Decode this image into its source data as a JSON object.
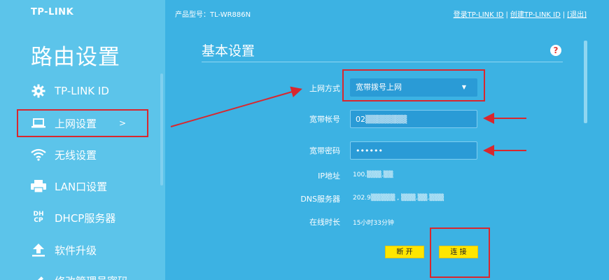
{
  "brand": "TP-LINK",
  "sidebar": {
    "title": "路由设置",
    "items": [
      {
        "label": "TP-LINK ID",
        "icon": "gear-icon"
      },
      {
        "label": "上网设置",
        "icon": "laptop-icon",
        "chevron": ">"
      },
      {
        "label": "无线设置",
        "icon": "wifi-icon"
      },
      {
        "label": "LAN口设置",
        "icon": "printer-icon"
      },
      {
        "label": "DHCP服务器",
        "icon": "dhcp-icon",
        "icon_text_top": "DH",
        "icon_text_bottom": "CP"
      },
      {
        "label": "软件升级",
        "icon": "upload-icon"
      },
      {
        "label": "修改管理员密码",
        "icon": "edit-icon"
      }
    ]
  },
  "header": {
    "model_label": "产品型号：TL-WR886N",
    "login_link": "登录TP-LINK ID",
    "sep1": "|",
    "create_link": "创建TP-LINK ID",
    "sep2": "|",
    "logout_link": "[退出]"
  },
  "section": {
    "title": "基本设置",
    "help": "?"
  },
  "form": {
    "connection_type_label": "上网方式",
    "connection_type_value": "宽带拨号上网",
    "account_label": "宽带帐号",
    "account_value": "02▒▒▒▒▒▒▒",
    "password_label": "宽带密码",
    "password_value": "••••••",
    "ip_label": "IP地址",
    "ip_value": "100.▒▒▒.▒▒",
    "dns_label": "DNS服务器",
    "dns_value": "202.9▒▒▒▒▒ , ▒▒▒.▒▒.▒▒▒",
    "uptime_label": "在线时长",
    "uptime_value": "15小时33分钟"
  },
  "buttons": {
    "disconnect": "断 开",
    "connect": "连 接"
  },
  "colors": {
    "sidebar_bg": "#5cc4ea",
    "main_bg": "#3cb2e3",
    "field_bg": "#2a9bd6",
    "button_bg": "#ffe600",
    "annotation_red": "#d9272e"
  }
}
